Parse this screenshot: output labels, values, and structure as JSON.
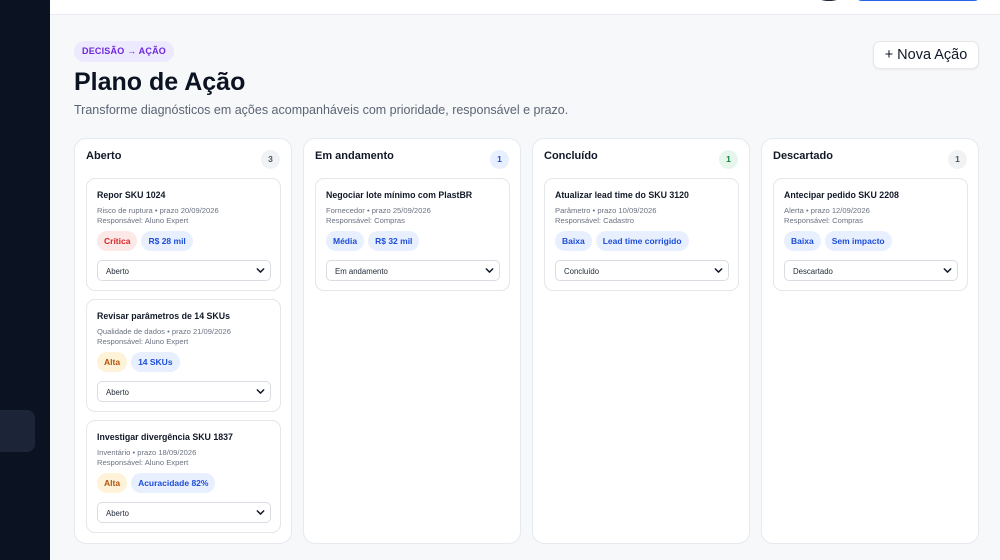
{
  "header": {
    "badge": "DECISÃO → AÇÃO",
    "title": "Plano de Ação",
    "subtitle": "Transforme diagnósticos em ações acompanháveis com prioridade, responsável e prazo.",
    "new_action_label": "+ Nova Ação"
  },
  "colors": {
    "sidebar_bg": "#0b1221",
    "primary": "#2563eb",
    "badge_bg": "#ede9fe",
    "badge_text": "#6d28d9"
  },
  "columns": [
    {
      "title": "Aberto",
      "count": "3",
      "cards": [
        {
          "title": "Repor SKU 1024",
          "meta": "Risco de ruptura • prazo 20/09/2026",
          "responsible": "Responsável: Aluno Expert",
          "priority": "Crítica",
          "impact": "R$ 28 mil",
          "status": "Aberto"
        },
        {
          "title": "Revisar parâmetros de 14 SKUs",
          "meta": "Qualidade de dados • prazo 21/09/2026",
          "responsible": "Responsável: Aluno Expert",
          "priority": "Alta",
          "impact": "14 SKUs",
          "status": "Aberto"
        },
        {
          "title": "Investigar divergência SKU 1837",
          "meta": "Inventário • prazo 18/09/2026",
          "responsible": "Responsável: Aluno Expert",
          "priority": "Alta",
          "impact": "Acuracidade 82%",
          "status": "Aberto"
        }
      ]
    },
    {
      "title": "Em andamento",
      "count": "1",
      "cards": [
        {
          "title": "Negociar lote mínimo com PlastBR",
          "meta": "Fornecedor • prazo 25/09/2026",
          "responsible": "Responsável: Compras",
          "priority": "Média",
          "impact": "R$ 32 mil",
          "status": "Em andamento"
        }
      ]
    },
    {
      "title": "Concluído",
      "count": "1",
      "cards": [
        {
          "title": "Atualizar lead time do SKU 3120",
          "meta": "Parâmetro • prazo 10/09/2026",
          "responsible": "Responsável: Cadastro",
          "priority": "Baixa",
          "impact": "Lead time corrigido",
          "status": "Concluído"
        }
      ]
    },
    {
      "title": "Descartado",
      "count": "1",
      "cards": [
        {
          "title": "Antecipar pedido SKU 2208",
          "meta": "Alerta • prazo 12/09/2026",
          "responsible": "Responsável: Compras",
          "priority": "Baixa",
          "impact": "Sem impacto",
          "status": "Descartado"
        }
      ]
    }
  ]
}
